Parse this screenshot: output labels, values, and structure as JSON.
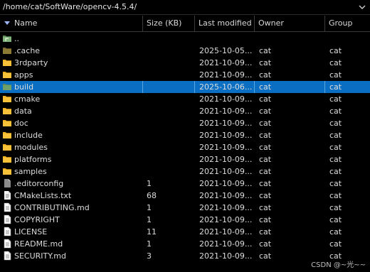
{
  "path": {
    "value": "/home/cat/SoftWare/opencv-4.5.4/"
  },
  "columns": {
    "name": "Name",
    "size": "Size (KB)",
    "modified": "Last modified",
    "owner": "Owner",
    "group": "Group"
  },
  "colors": {
    "selection": "#0a6fc2",
    "folder": "#f2b01e",
    "folder_dark": "#7a6a2e",
    "folder_green": "#6fa06a"
  },
  "files": [
    {
      "name": "..",
      "icon": "parent-folder-icon",
      "size": "",
      "modified": "",
      "owner": "",
      "group": ""
    },
    {
      "name": ".cache",
      "icon": "hidden-folder-icon",
      "size": "",
      "modified": "2025-10-05...",
      "owner": "cat",
      "group": "cat"
    },
    {
      "name": "3rdparty",
      "icon": "folder-icon",
      "size": "",
      "modified": "2021-10-09...",
      "owner": "cat",
      "group": "cat"
    },
    {
      "name": "apps",
      "icon": "folder-icon",
      "size": "",
      "modified": "2021-10-09...",
      "owner": "cat",
      "group": "cat"
    },
    {
      "name": "build",
      "icon": "build-folder-icon",
      "size": "",
      "modified": "2025-10-06...",
      "owner": "cat",
      "group": "cat",
      "selected": true
    },
    {
      "name": "cmake",
      "icon": "folder-icon",
      "size": "",
      "modified": "2021-10-09...",
      "owner": "cat",
      "group": "cat"
    },
    {
      "name": "data",
      "icon": "folder-icon",
      "size": "",
      "modified": "2021-10-09...",
      "owner": "cat",
      "group": "cat"
    },
    {
      "name": "doc",
      "icon": "folder-icon",
      "size": "",
      "modified": "2021-10-09...",
      "owner": "cat",
      "group": "cat"
    },
    {
      "name": "include",
      "icon": "folder-icon",
      "size": "",
      "modified": "2021-10-09...",
      "owner": "cat",
      "group": "cat"
    },
    {
      "name": "modules",
      "icon": "folder-icon",
      "size": "",
      "modified": "2021-10-09...",
      "owner": "cat",
      "group": "cat"
    },
    {
      "name": "platforms",
      "icon": "folder-icon",
      "size": "",
      "modified": "2021-10-09...",
      "owner": "cat",
      "group": "cat"
    },
    {
      "name": "samples",
      "icon": "folder-icon",
      "size": "",
      "modified": "2021-10-09...",
      "owner": "cat",
      "group": "cat"
    },
    {
      "name": ".editorconfig",
      "icon": "config-file-icon",
      "size": "1",
      "modified": "2021-10-09...",
      "owner": "cat",
      "group": "cat"
    },
    {
      "name": "CMakeLists.txt",
      "icon": "text-file-icon",
      "size": "68",
      "modified": "2021-10-09...",
      "owner": "cat",
      "group": "cat"
    },
    {
      "name": "CONTRIBUTING.md",
      "icon": "document-file-icon",
      "size": "1",
      "modified": "2021-10-09...",
      "owner": "cat",
      "group": "cat"
    },
    {
      "name": "COPYRIGHT",
      "icon": "document-file-icon",
      "size": "1",
      "modified": "2021-10-09...",
      "owner": "cat",
      "group": "cat"
    },
    {
      "name": "LICENSE",
      "icon": "document-file-icon",
      "size": "11",
      "modified": "2021-10-09...",
      "owner": "cat",
      "group": "cat"
    },
    {
      "name": "README.md",
      "icon": "document-file-icon",
      "size": "1",
      "modified": "2021-10-09...",
      "owner": "cat",
      "group": "cat"
    },
    {
      "name": "SECURITY.md",
      "icon": "document-file-icon",
      "size": "3",
      "modified": "2021-10-09...",
      "owner": "cat",
      "group": "cat"
    }
  ],
  "watermark": "CSDN @~光~~"
}
